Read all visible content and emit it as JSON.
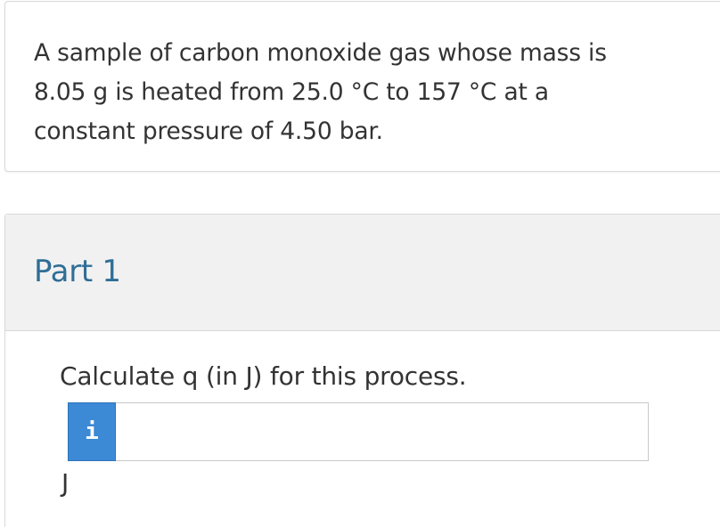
{
  "problem": {
    "text": "A sample of carbon monoxide gas whose mass is 8.05 g is heated from 25.0 °C to 157 °C at a constant pressure of 4.50 bar."
  },
  "part": {
    "title": "Part 1",
    "question": "Calculate q (in J) for this process.",
    "info_icon": "info-icon",
    "info_glyph": "i",
    "input_value": "",
    "input_placeholder": "",
    "unit": "J"
  },
  "colors": {
    "accent_blue": "#3c89d6",
    "part_title": "#2f6e97",
    "header_bg": "#f1f1f1",
    "text": "#333333"
  }
}
